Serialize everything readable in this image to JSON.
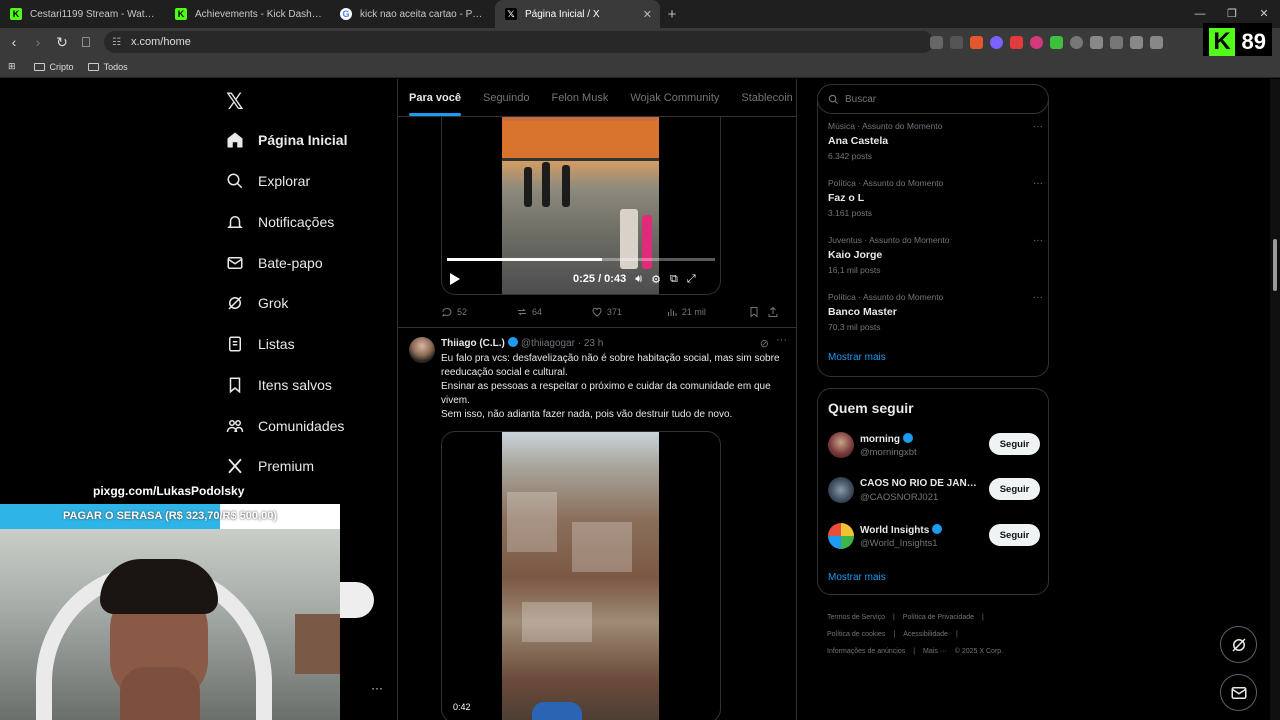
{
  "browser": {
    "tabs": [
      {
        "title": "Cestari1199 Stream - Watch Live on K",
        "icon": "kick-icon",
        "color": "#53fc18",
        "active": false
      },
      {
        "title": "Achievements - Kick Dashboard",
        "icon": "kick-icon",
        "color": "#53fc18",
        "active": false
      },
      {
        "title": "kick nao aceita cartao - Pesquisa Goo",
        "icon": "google-icon",
        "color": "#ffffff",
        "active": false
      },
      {
        "title": "Página Inicial / X",
        "icon": "x-icon",
        "color": "#000000",
        "active": true
      }
    ],
    "url": "x.com/home",
    "bookmarks": [
      "Cripto",
      "Todos"
    ],
    "kick_viewers": "89"
  },
  "nav": {
    "items": [
      {
        "label": "Página Inicial",
        "icon": "home-icon",
        "bold": true
      },
      {
        "label": "Explorar",
        "icon": "search-icon"
      },
      {
        "label": "Notificações",
        "icon": "bell-icon"
      },
      {
        "label": "Bate-papo",
        "icon": "mail-icon"
      },
      {
        "label": "Grok",
        "icon": "grok-icon"
      },
      {
        "label": "Listas",
        "icon": "list-icon"
      },
      {
        "label": "Itens salvos",
        "icon": "bookmark-icon"
      },
      {
        "label": "Comunidades",
        "icon": "communities-icon"
      },
      {
        "label": "Premium",
        "icon": "x-icon"
      }
    ]
  },
  "timeline": {
    "tabs": [
      "Para você",
      "Seguindo",
      "Felon Musk",
      "Wojak Community",
      "Stablecoin"
    ],
    "active_tab": "Para você",
    "post1": {
      "video_time": "0:25 / 0:43",
      "progress": 0.58,
      "replies": "52",
      "reposts": "64",
      "likes": "371",
      "views": "21 mil"
    },
    "post2": {
      "name": "Thiiago (C.L.)",
      "handle": "@thiiagogar",
      "time": "· 23 h",
      "lines": [
        "Eu falo pra vcs: desfavelização não é sobre habitação social, mas sim sobre reeducação social e cultural.",
        "Ensinar as pessoas a respeitar o próximo e cuidar da comunidade em que vivem.",
        "Sem isso, não adianta fazer nada, pois vão destruir tudo de novo."
      ],
      "video_duration": "0:42"
    }
  },
  "sidebar": {
    "search_placeholder": "Buscar",
    "trends": [
      {
        "category": "Música · Assunto do Momento",
        "title": "Ana Castela",
        "count": "6.342 posts"
      },
      {
        "category": "Política · Assunto do Momento",
        "title": "Faz o L",
        "count": "3.161 posts"
      },
      {
        "category": "Juventus · Assunto do Momento",
        "title": "Kaio Jorge",
        "count": "16,1 mil posts"
      },
      {
        "category": "Política · Assunto do Momento",
        "title": "Banco Master",
        "count": "70,3 mil posts"
      }
    ],
    "show_more": "Mostrar mais",
    "who_to_follow_title": "Quem seguir",
    "who_to_follow": [
      {
        "name": "morning",
        "handle": "@morningxbt",
        "verified": true,
        "avatar_color": "#7a3b3b"
      },
      {
        "name": "CAOS NO RIO DE JANE...",
        "handle": "@CAOSNORJ021",
        "verified": false,
        "avatar_color": "#3b4a5a"
      },
      {
        "name": "World Insights",
        "handle": "@World_Insights1",
        "verified": true,
        "avatar_color": "#f2c230"
      }
    ],
    "follow_label": "Seguir",
    "footer": [
      "Termos de Serviço",
      "|",
      "Política de Privacidade",
      "|",
      "Política de cookies",
      "|",
      "Acessibilidade",
      "|",
      "Informações de anúncios",
      "|",
      "Mais ···",
      "© 2025 X Corp."
    ]
  },
  "stream_overlay": {
    "pix": "pixgg.com/LukasPodolsky",
    "goal_label": "PAGAR O SERASA (R$ 323,70/R$ 500,00)",
    "goal_progress": 0.6474
  }
}
